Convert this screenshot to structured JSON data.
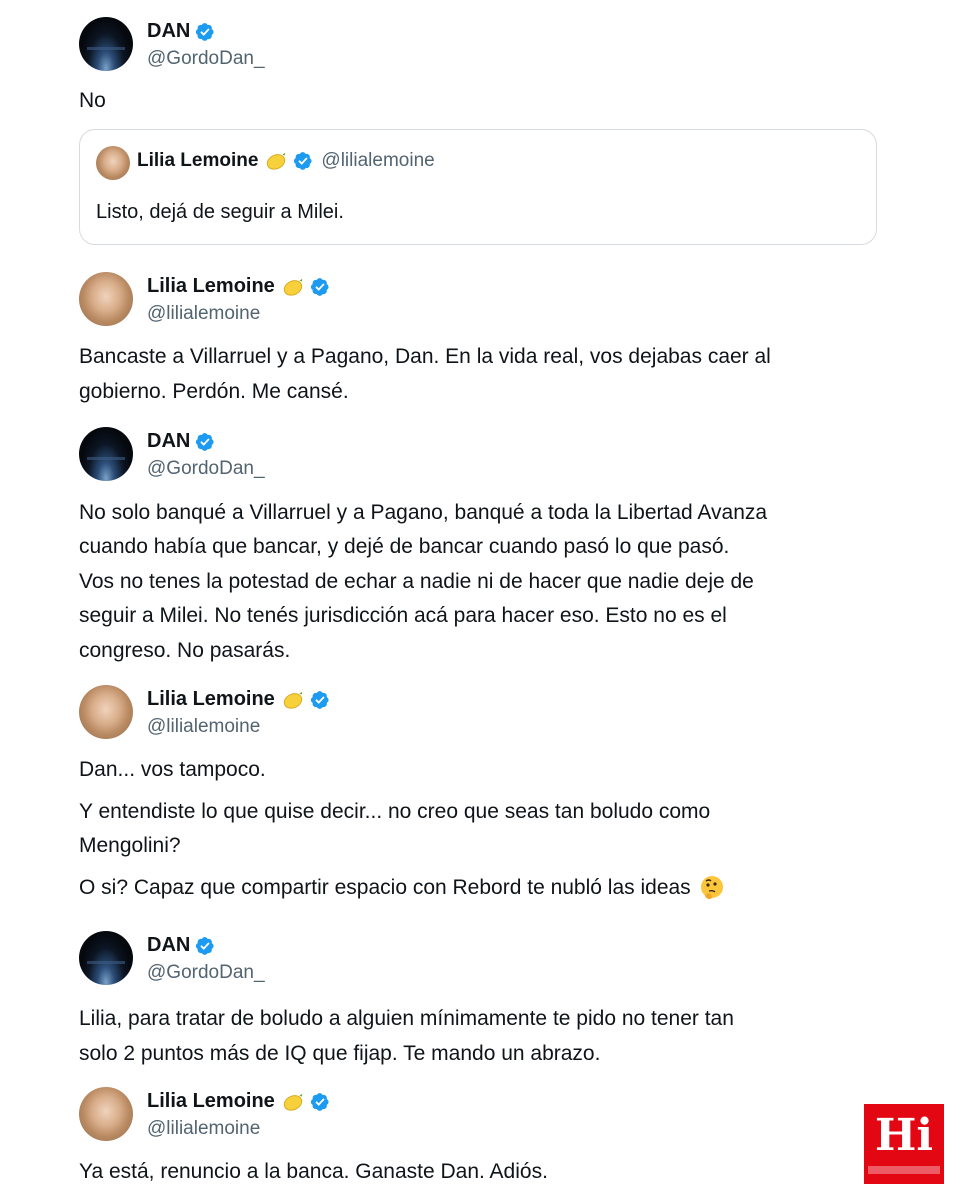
{
  "thread": {
    "tweet1": {
      "author": {
        "name": "DAN",
        "handle": "@GordoDan_"
      },
      "text": "No",
      "quote": {
        "author": {
          "name": "Lilia Lemoine",
          "handle": "@lilialemoine"
        },
        "text": "Listo, dejá de seguir a Milei."
      }
    },
    "tweet2": {
      "author": {
        "name": "Lilia Lemoine",
        "handle": "@lilialemoine"
      },
      "lines": [
        "Bancaste a Villarruel y a Pagano, Dan. En la vida real, vos dejabas caer al",
        "gobierno. Perdón. Me cansé."
      ]
    },
    "tweet3": {
      "author": {
        "name": "DAN",
        "handle": "@GordoDan_"
      },
      "lines": [
        "No solo banqué a Villarruel y a Pagano, banqué a toda la Libertad Avanza",
        "cuando había que bancar, y dejé de bancar cuando pasó lo que pasó.",
        "Vos no tenes la potestad de echar a nadie ni de hacer que nadie deje de",
        "seguir a Milei. No tenés jurisdicción acá para hacer eso. Esto no es el",
        "congreso. No pasarás."
      ]
    },
    "tweet4": {
      "author": {
        "name": "Lilia Lemoine",
        "handle": "@lilialemoine"
      },
      "lines": [
        "Dan... vos tampoco.",
        "Y entendiste lo que quise decir... no creo que seas tan boludo como",
        "Mengolini?",
        "O si? Capaz que compartir espacio con Rebord te nubló las ideas"
      ]
    },
    "tweet5": {
      "author": {
        "name": "DAN",
        "handle": "@GordoDan_"
      },
      "lines": [
        "Lilia, para tratar de boludo a alguien mínimamente te pido no tener tan",
        "solo 2 puntos más de IQ que fijap. Te mando un abrazo."
      ]
    },
    "tweet6": {
      "author": {
        "name": "Lilia Lemoine",
        "handle": "@lilialemoine"
      },
      "lines": [
        "Ya está, renuncio a la banca. Ganaste Dan. Adiós."
      ]
    }
  },
  "watermark": {
    "label": "Hi"
  },
  "icons": {
    "verified": "verified-badge-icon",
    "lemon": "lemon-emoji-icon",
    "thinking": "thinking-face-emoji-icon"
  },
  "colors": {
    "verified_blue": "#1d9bf0",
    "handle_gray": "#536471",
    "text_dark": "#0f1419",
    "logo_red": "#e30613"
  }
}
